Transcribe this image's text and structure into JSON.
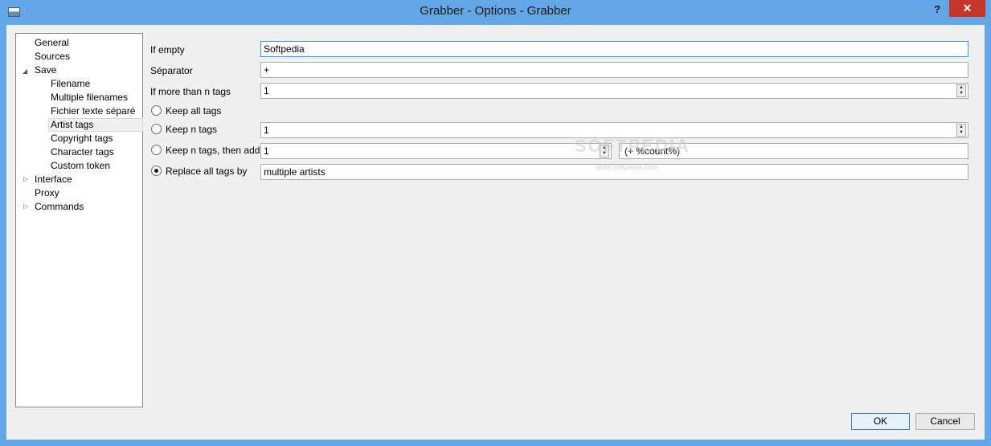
{
  "window": {
    "title": "Grabber - Options - Grabber",
    "help_label": "?",
    "close_label": "✕"
  },
  "tree": {
    "items": [
      {
        "label": "General"
      },
      {
        "label": "Sources"
      },
      {
        "label": "Save",
        "expander": "◢"
      },
      {
        "label": "Filename"
      },
      {
        "label": "Multiple filenames"
      },
      {
        "label": "Fichier texte séparé"
      },
      {
        "label": "Artist tags",
        "selected": true
      },
      {
        "label": "Copyright tags"
      },
      {
        "label": "Character tags"
      },
      {
        "label": "Custom token"
      },
      {
        "label": "Interface",
        "expander": "▷"
      },
      {
        "label": "Proxy"
      },
      {
        "label": "Commands",
        "expander": "▷"
      }
    ]
  },
  "form": {
    "if_empty": {
      "label": "If empty",
      "value": "Softpedia"
    },
    "separator": {
      "label": "Séparator",
      "value": "+"
    },
    "if_more": {
      "label": "If more than n tags",
      "value": "1"
    },
    "keep_all": {
      "label": "Keep all tags",
      "checked": false
    },
    "keep_n": {
      "label": "Keep n tags",
      "value": "1",
      "checked": false
    },
    "keep_n_add": {
      "label": "Keep n tags, then add",
      "value": "1",
      "suffix": "(+ %count%)",
      "checked": false
    },
    "replace_all": {
      "label": "Replace all tags by",
      "value": "multiple artists",
      "checked": true
    }
  },
  "buttons": {
    "ok_label": "OK",
    "cancel_label": "Cancel"
  },
  "watermark": {
    "logo_text": "SOFTPEDIA",
    "url_text": "www.softpedia.com"
  }
}
